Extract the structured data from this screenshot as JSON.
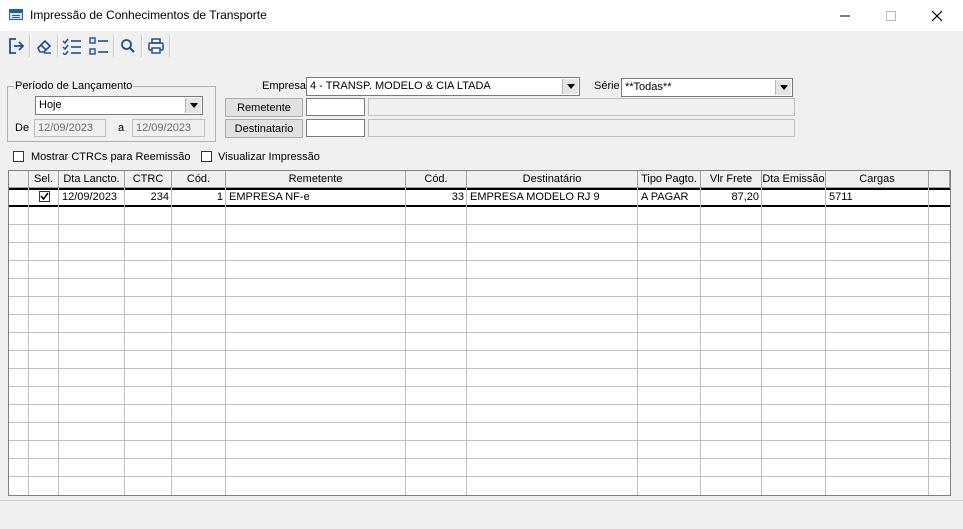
{
  "window": {
    "title": "Impressão de Conhecimentos de Transporte",
    "minimize": "—",
    "maximize": "☐",
    "close": "✕",
    "icon": "window-app-icon"
  },
  "toolbar": {
    "buttons": [
      {
        "name": "exit-icon"
      },
      {
        "name": "eraser-icon"
      },
      {
        "name": "select-all-list-icon"
      },
      {
        "name": "unselect-list-icon"
      },
      {
        "name": "search-icon"
      },
      {
        "name": "printer-icon"
      }
    ]
  },
  "filters": {
    "periodo_legend": "Período de Lançamento",
    "periodo_value": "Hoje",
    "de_label": "De",
    "de_value": "12/09/2023",
    "a_label": "a",
    "a_value": "12/09/2023",
    "empresa_label": "Empresa",
    "empresa_value": "4 - TRANSP. MODELO & CIA LTADA",
    "serie_label": "Série",
    "serie_value": "**Todas**",
    "remetente_button": "Remetente",
    "destinatario_button": "Destinatario",
    "remetente_code": "",
    "remetente_name": "",
    "destinatario_code": "",
    "destinatario_name": "",
    "mostrar_label": "Mostrar CTRCs para Reemissão",
    "mostrar_checked": false,
    "visualizar_label": "Visualizar Impressão",
    "visualizar_checked": false
  },
  "grid": {
    "columns": [
      "Sel.",
      "Dta Lancto.",
      "CTRC",
      "Cód.",
      "Remetente",
      "Cód.",
      "Destinatário",
      "Tipo Pagto.",
      "Vlr Frete",
      "Dta Emissão",
      "Cargas"
    ],
    "rows": [
      {
        "sel": true,
        "dta_lancto": "12/09/2023",
        "ctrc": "234",
        "cod_rem": "1",
        "remetente": "EMPRESA NF-e",
        "cod_dest": "33",
        "destinatario": "EMPRESA MODELO RJ 9",
        "tipo_pagto": "A PAGAR",
        "vlr_frete": "87,20",
        "dta_emissao": "",
        "cargas": "5711"
      }
    ]
  }
}
